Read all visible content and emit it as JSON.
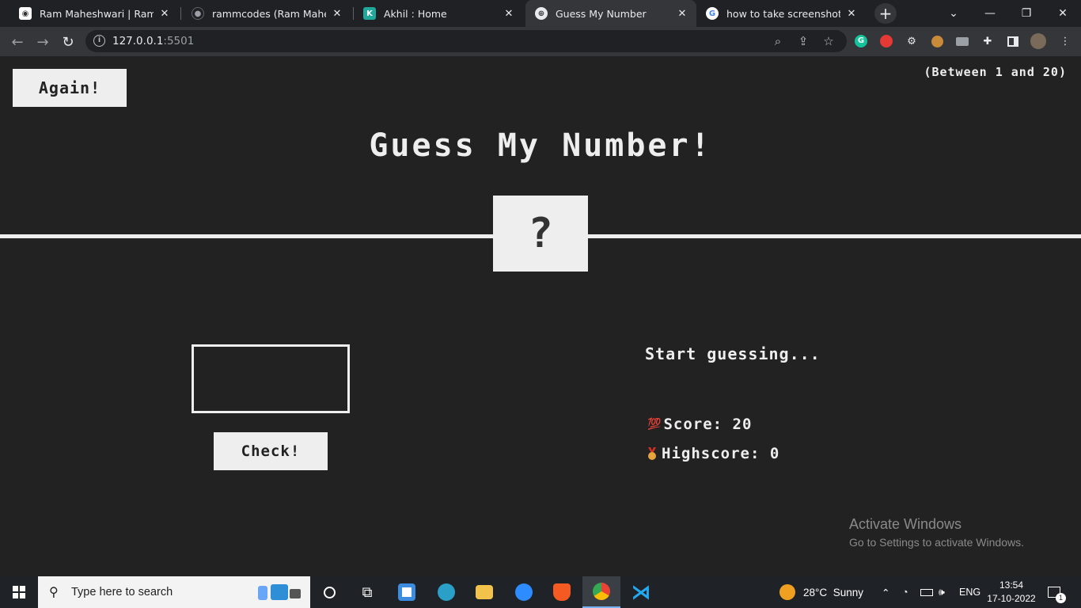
{
  "browser": {
    "tabs": [
      {
        "title": "Ram Maheshwari | RammCodes",
        "favicon": "person-photo-icon",
        "active": false
      },
      {
        "title": "rammcodes (Ram Maheshwari)",
        "favicon": "github-icon",
        "active": false
      },
      {
        "title": "Akhil : Home",
        "favicon": "k-logo-icon",
        "active": false
      },
      {
        "title": "Guess My Number",
        "favicon": "globe-icon",
        "active": true
      },
      {
        "title": "how to take screenshot on laptop",
        "favicon": "google-icon",
        "active": false
      }
    ],
    "url_host": "127.0.0.1",
    "url_port": ":5501"
  },
  "game": {
    "again_label": "Again!",
    "range_hint": "(Between 1 and 20)",
    "title": "Guess My Number!",
    "secret_number_display": "?",
    "guess_value": "",
    "check_label": "Check!",
    "message": "Start guessing...",
    "score_label": "Score:",
    "score_value": "20",
    "highscore_label": "Highscore:",
    "highscore_value": "0",
    "score_emoji": "💯"
  },
  "watermark": {
    "line1": "Activate Windows",
    "line2": "Go to Settings to activate Windows."
  },
  "taskbar": {
    "search_placeholder": "Type here to search",
    "weather_temp": "28°C",
    "weather_desc": "Sunny",
    "language": "ENG",
    "time": "13:54",
    "date": "17-10-2022",
    "notification_count": "1"
  }
}
